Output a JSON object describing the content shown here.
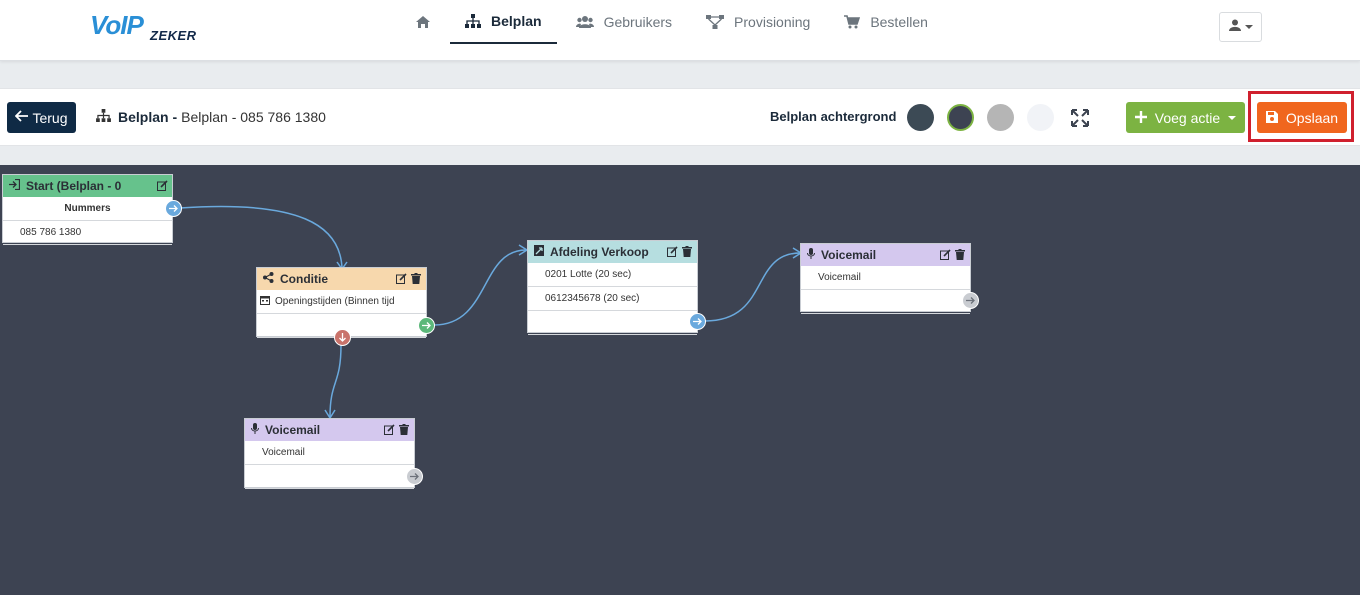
{
  "brand": {
    "logo_main": "VoIP",
    "logo_sub": "ZEKER"
  },
  "nav": {
    "items": [
      {
        "label": "",
        "icon": "home-icon"
      },
      {
        "label": "Belplan",
        "icon": "sitemap-icon",
        "active": true
      },
      {
        "label": "Gebruikers",
        "icon": "users-icon"
      },
      {
        "label": "Provisioning",
        "icon": "network-icon"
      },
      {
        "label": "Bestellen",
        "icon": "cart-icon"
      }
    ],
    "user_icon": "user-icon"
  },
  "toolbar": {
    "back_label": "Terug",
    "breadcrumb_bold": "Belplan -",
    "breadcrumb_text": "Belplan - 085 786 1380",
    "background_label": "Belplan achtergrond",
    "swatches": [
      "#3c4a55",
      "#3d4352",
      "#b5b5b5",
      "#f1f3f7"
    ],
    "add_label": "Voeg actie",
    "save_label": "Opslaan",
    "colors": {
      "back": "#0f2a45",
      "add": "#7cb342",
      "save": "#f0661e",
      "highlight": "#d0202e"
    }
  },
  "canvas": {
    "background": "#3d4352",
    "nodes": {
      "start": {
        "title": "Start (Belplan - 0",
        "header_label": "Nummers",
        "number": "085 786 1380"
      },
      "conditie": {
        "title": "Conditie",
        "row": "Openingstijden (Binnen tijd"
      },
      "afdeling": {
        "title": "Afdeling Verkoop",
        "rows": [
          "0201 Lotte (20 sec)",
          "0612345678 (20 sec)"
        ]
      },
      "voicemail_right": {
        "title": "Voicemail",
        "row": "Voicemail"
      },
      "voicemail_bottom": {
        "title": "Voicemail",
        "row": "Voicemail"
      }
    }
  }
}
